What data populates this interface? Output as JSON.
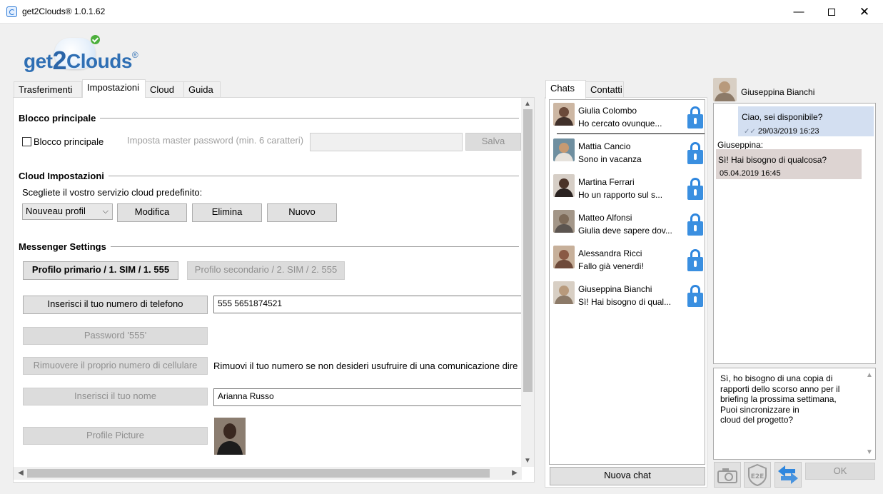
{
  "window": {
    "title": "get2Clouds® 1.0.1.62",
    "controls": {
      "minimize": "—",
      "close": "✕"
    }
  },
  "logo": {
    "prefix": "get",
    "two": "2",
    "suffix": "Clouds",
    "registered": "®"
  },
  "tabs": [
    "Trasferimenti",
    "Impostazioni",
    "Cloud",
    "Guida"
  ],
  "active_tab": "Impostazioni",
  "settings": {
    "master_lock": {
      "section_title": "Blocco principale",
      "checkbox_label": "Blocco principale",
      "checked": false,
      "password_label": "Imposta master password (min. 6 caratteri)",
      "password_value": "",
      "save_label": "Salva"
    },
    "cloud": {
      "section_title": "Cloud Impostazioni",
      "prompt": "Scegliete il vostro servizio cloud predefinito:",
      "selected_profile": "Nouveau profil",
      "modify_label": "Modifica",
      "delete_label": "Elimina",
      "new_label": "Nuovo"
    },
    "messenger": {
      "section_title": "Messenger Settings",
      "primary_profile_label": "Profilo primario / 1. SIM / 1. 555",
      "secondary_profile_label": "Profilo secondario / 2. SIM / 2. 555",
      "phone_button_label": "Inserisci il tuo numero di telefono",
      "phone_value": "555 5651874521",
      "password_button_label": "Password '555'",
      "remove_button_label": "Rimuovere il proprio numero di cellulare",
      "remove_hint": "Rimuovi il tuo numero se non desideri usufruire di una comunicazione dire",
      "name_button_label": "Inserisci il tuo nome",
      "name_value": "Arianna Russo",
      "picture_button_label": "Profile Picture"
    }
  },
  "chat_tabs": [
    "Chats",
    "Contatti"
  ],
  "chats": [
    {
      "name": "Giulia Colombo",
      "preview": "Ho cercato ovunque...",
      "avatar_color": "#6b4a3a"
    },
    {
      "name": "Mattia Cancio",
      "preview": "Sono in vacanza",
      "avatar_color": "#c79a72"
    },
    {
      "name": "Martina Ferrari",
      "preview": "Ho un rapporto sul s...",
      "avatar_color": "#4a3328"
    },
    {
      "name": "Matteo Alfonsi",
      "preview": "Giulia deve sapere dov...",
      "avatar_color": "#7d6a58"
    },
    {
      "name": "Alessandra Ricci",
      "preview": "Fallo già venerdì!",
      "avatar_color": "#8a5a44"
    },
    {
      "name": "Giuseppina Bianchi",
      "preview": "Sì! Hai bisogno di qual...",
      "avatar_color": "#b89a7c"
    }
  ],
  "new_chat_label": "Nuova chat",
  "conversation": {
    "peer_name": "Giuseppina Bianchi",
    "messages": [
      {
        "from": "me",
        "text": "Ciao, sei disponibile?",
        "time": "29/03/2019 16:23"
      },
      {
        "from": "them",
        "sender": "Giuseppina:",
        "text": "Sì! Hai bisogno di qualcosa?",
        "time": "05.04.2019 16:45"
      }
    ],
    "draft_lines": [
      "Sì, ho bisogno di una copia di",
      "rapporti dello scorso anno per il",
      "briefing la prossima settimana,",
      "Puoi sincronizzare in",
      "cloud del progetto?"
    ],
    "ok_label": "OK",
    "e2e_label": "E2E"
  },
  "colors": {
    "lock_blue": "#2e86de",
    "me_bubble": "#d3dff1",
    "them_bubble": "#ddd4d2",
    "brand_blue": "#2f6fb4"
  }
}
